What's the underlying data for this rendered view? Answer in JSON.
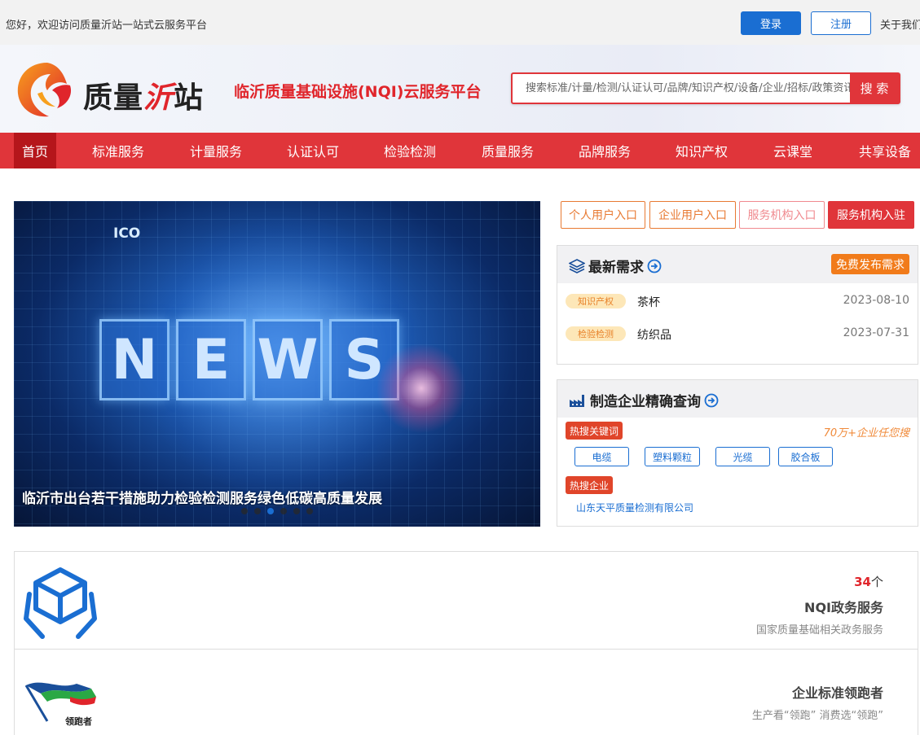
{
  "topbar": {
    "welcome": "您好，欢迎访问质量沂站一站式云服务平台",
    "login_label": "登录",
    "register_label": "注册",
    "about_label": "关于我们"
  },
  "header": {
    "logo_text_a": "质量",
    "logo_text_b": "沂",
    "logo_text_c": "站",
    "slogan": "临沂质量基础设施(NQI)云服务平台",
    "search_placeholder": "搜索标准/计量/检测/认证认可/品牌/知识产权/设备/企业/招标/政策资讯",
    "search_button": "搜 索"
  },
  "nav": {
    "items": [
      "首页",
      "标准服务",
      "计量服务",
      "认证认可",
      "检验检测",
      "质量服务",
      "品牌服务",
      "知识产权",
      "云课堂",
      "共享设备"
    ]
  },
  "banner": {
    "badge": "ICO",
    "letters": [
      "N",
      "E",
      "W",
      "S"
    ],
    "caption": "临沂市出台若干措施助力检验检测服务绿色低碳高质量发展"
  },
  "entries": {
    "personal": "个人用户入口",
    "enterprise": "企业用户入口",
    "agency": "服务机构入口",
    "join": "服务机构入驻"
  },
  "demand": {
    "title": "最新需求",
    "publish_label": "免费发布需求",
    "rows": [
      {
        "tag": "知识产权",
        "name": "茶杯",
        "date": "2023-08-10"
      },
      {
        "tag": "检验检测",
        "name": "纺织品",
        "date": "2023-07-31"
      }
    ]
  },
  "query": {
    "title": "制造企业精确查询",
    "hot_keywords_label": "热搜关键词",
    "tip": "70万+企业任您搜",
    "keywords": [
      "电缆",
      "塑料颗粒",
      "光缆",
      "胶合板"
    ],
    "hot_company_label": "热搜企业",
    "company": "山东天平质量检测有限公司"
  },
  "cards": [
    {
      "count": "34",
      "unit": "个",
      "title": "NQI政务服务",
      "desc": "国家质量基础相关政务服务"
    },
    {
      "title": "企业标准领跑者",
      "desc": "生产看“领跑” 消费选“领跑”",
      "logo_text": "领跑者"
    }
  ],
  "colors": {
    "brand_red": "#e0353a",
    "brand_blue": "#1a6ed2",
    "accent_orange": "#f17b1a"
  }
}
